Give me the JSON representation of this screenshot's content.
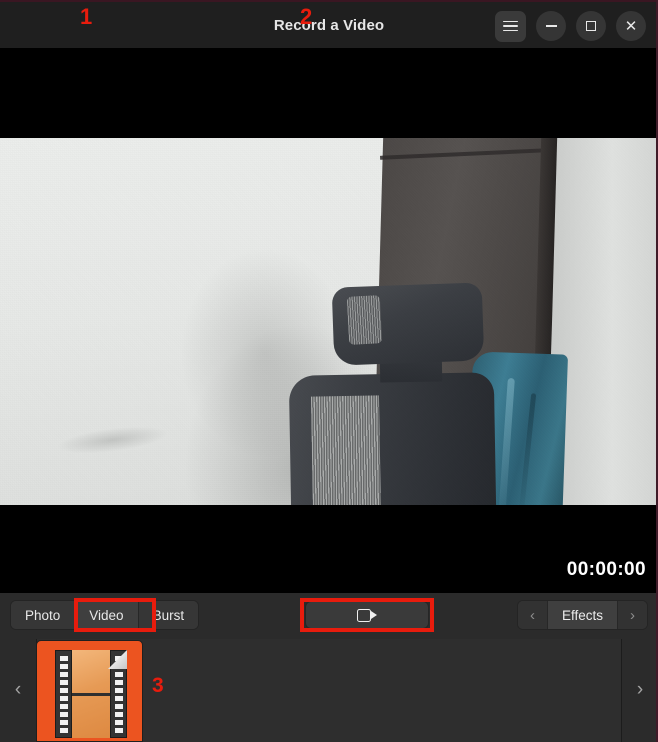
{
  "window": {
    "title": "Record a Video",
    "controls": [
      {
        "name": "menu",
        "icon": "hamburger-icon",
        "label": "☰"
      },
      {
        "name": "minimize",
        "icon": "minimize-icon",
        "label": "–"
      },
      {
        "name": "maximize",
        "icon": "maximize-icon",
        "label": "□"
      },
      {
        "name": "close",
        "icon": "close-icon",
        "label": "✕"
      }
    ]
  },
  "viewfinder": {
    "description": "Live webcam preview of a room: office chair with mesh back and headrest, teal cloth draped over it, light grey wall with shadow",
    "letterboxed": true
  },
  "status": {
    "timer": "00:00:00"
  },
  "toolbar": {
    "modes": [
      {
        "label": "Photo",
        "active": false
      },
      {
        "label": "Video",
        "active": true
      },
      {
        "label": "Burst",
        "active": false
      }
    ],
    "record": {
      "icon": "camcorder-icon",
      "label": ""
    },
    "effects": {
      "prev": "‹",
      "label": "Effects",
      "next": "›"
    }
  },
  "gallery": {
    "prev_arrow": "‹",
    "next_arrow": "›",
    "items": [
      {
        "name": "video-file-thumbnail",
        "icon": "video-file-icon"
      }
    ]
  },
  "annotations": [
    {
      "id": "1",
      "target": "video-mode-button"
    },
    {
      "id": "2",
      "target": "record-button"
    },
    {
      "id": "3",
      "target": "video-file-thumbnail"
    }
  ],
  "colors": {
    "annotation": "#e81c0d",
    "thumbnail_orange": "#ec5420",
    "toolbar_bg": "#2b2b2b",
    "titlebar_bg": "#1f1f1f"
  }
}
